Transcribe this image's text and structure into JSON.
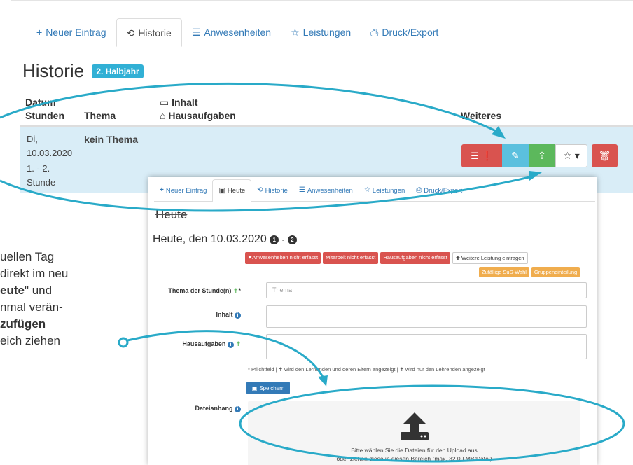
{
  "back": {
    "tabs": [
      {
        "label": "Neuer Eintrag",
        "icon": "plus-icon"
      },
      {
        "label": "Historie",
        "icon": "history-icon"
      },
      {
        "label": "Anwesenheiten",
        "icon": "list-icon"
      },
      {
        "label": "Leistungen",
        "icon": "star-icon"
      },
      {
        "label": "Druck/Export",
        "icon": "print-icon"
      }
    ],
    "title": "Historie",
    "title_badge": "2. Halbjahr",
    "headers": {
      "datum": "Datum",
      "stunden": "Stunden",
      "thema": "Thema",
      "inhalt": "Inhalt",
      "hausaufgaben": "Hausaufgaben",
      "weiteres": "Weiteres"
    },
    "row": {
      "day": "Di,",
      "date": "10.03.2020",
      "hours": "1. - 2.",
      "hours_unit": "Stunde",
      "topic": "kein Thema"
    }
  },
  "front": {
    "tabs": [
      {
        "label": "Neuer Eintrag"
      },
      {
        "label": "Heute"
      },
      {
        "label": "Historie"
      },
      {
        "label": "Anwesenheiten"
      },
      {
        "label": "Leistungen"
      },
      {
        "label": "Druck/Export"
      }
    ],
    "struck_title": "Heute",
    "date_title": "Heute, den 10.03.2020",
    "hour_from": "1",
    "hour_sep": "-",
    "hour_to": "2",
    "status_badges": [
      "✖Anwesenheiten nicht erfasst",
      "Mitarbeit nicht erfasst",
      "Hausaufgaben nicht erfasst",
      "✚ Weitere Leistung eintragen"
    ],
    "action_badges": [
      "Zufällige SuS-Wahl",
      "Gruppeneinteilung"
    ],
    "fields": {
      "thema_label": "Thema der Stunde(n)",
      "thema_placeholder": "Thema",
      "inhalt_label": "Inhalt",
      "hausaufgaben_label": "Hausaufgaben",
      "dateianhang_label": "Dateianhang"
    },
    "hint_text": "* Pflichtfeld | ✝ wird den Lernenden und deren Eltern angezeigt | ✝ wird nur den Lehrenden angezeigt",
    "save_label": "Speichern",
    "drop_line1": "Bitte wählen Sie die Dateien für den Upload aus",
    "drop_line2": "oder ziehen diese in diesen Bereich (max. 32,00 MB/Datei)"
  },
  "sidetext": {
    "l1": "uellen Tag",
    "l2": "direkt im neu",
    "l3_bold": "eute",
    "l3_rest": "\" und",
    "l4": "nmal verän-",
    "l5": "zufügen",
    "l6": "eich ziehen"
  },
  "colors": {
    "link": "#337ab7",
    "danger": "#d9534f",
    "info": "#5bc0de",
    "success": "#5cb85c",
    "warning": "#f0ad4e",
    "highlight_row": "#d9edf7",
    "annotation": "#29aac8"
  }
}
